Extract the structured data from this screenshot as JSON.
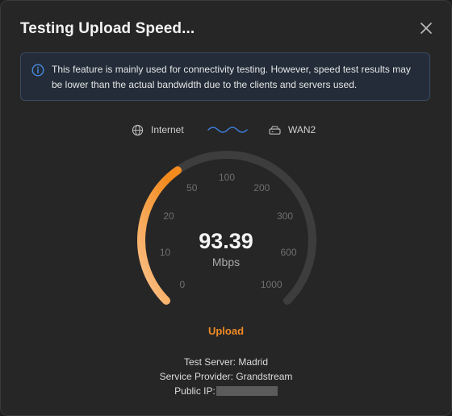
{
  "dialog": {
    "title": "Testing Upload Speed...",
    "close_icon": "close-icon"
  },
  "notice": {
    "icon": "info-icon",
    "text": "This feature is mainly used for connectivity testing. However, speed test results may be lower than the actual bandwidth due to the clients and servers used.",
    "accent_color": "#4a8fe7"
  },
  "connection": {
    "source_icon": "globe-icon",
    "source_label": "Internet",
    "link_icon": "wave-icon",
    "target_icon": "router-icon",
    "target_label": "WAN2"
  },
  "gauge": {
    "value": "93.39",
    "unit": "Mbps",
    "mode": "Upload",
    "scale_labels": [
      "0",
      "10",
      "20",
      "50",
      "100",
      "200",
      "300",
      "600",
      "1000"
    ],
    "progress_fraction": 0.37,
    "colors": {
      "track": "#3d3d3d",
      "gradient_start": "#fbc58f",
      "gradient_end": "#f28a1e",
      "scale_text": "#6f6f6f"
    }
  },
  "details": {
    "server_label": "Test Server:",
    "server_value": "Madrid",
    "provider_label": "Service Provider:",
    "provider_value": "Grandstream",
    "ip_label": "Public IP:"
  }
}
